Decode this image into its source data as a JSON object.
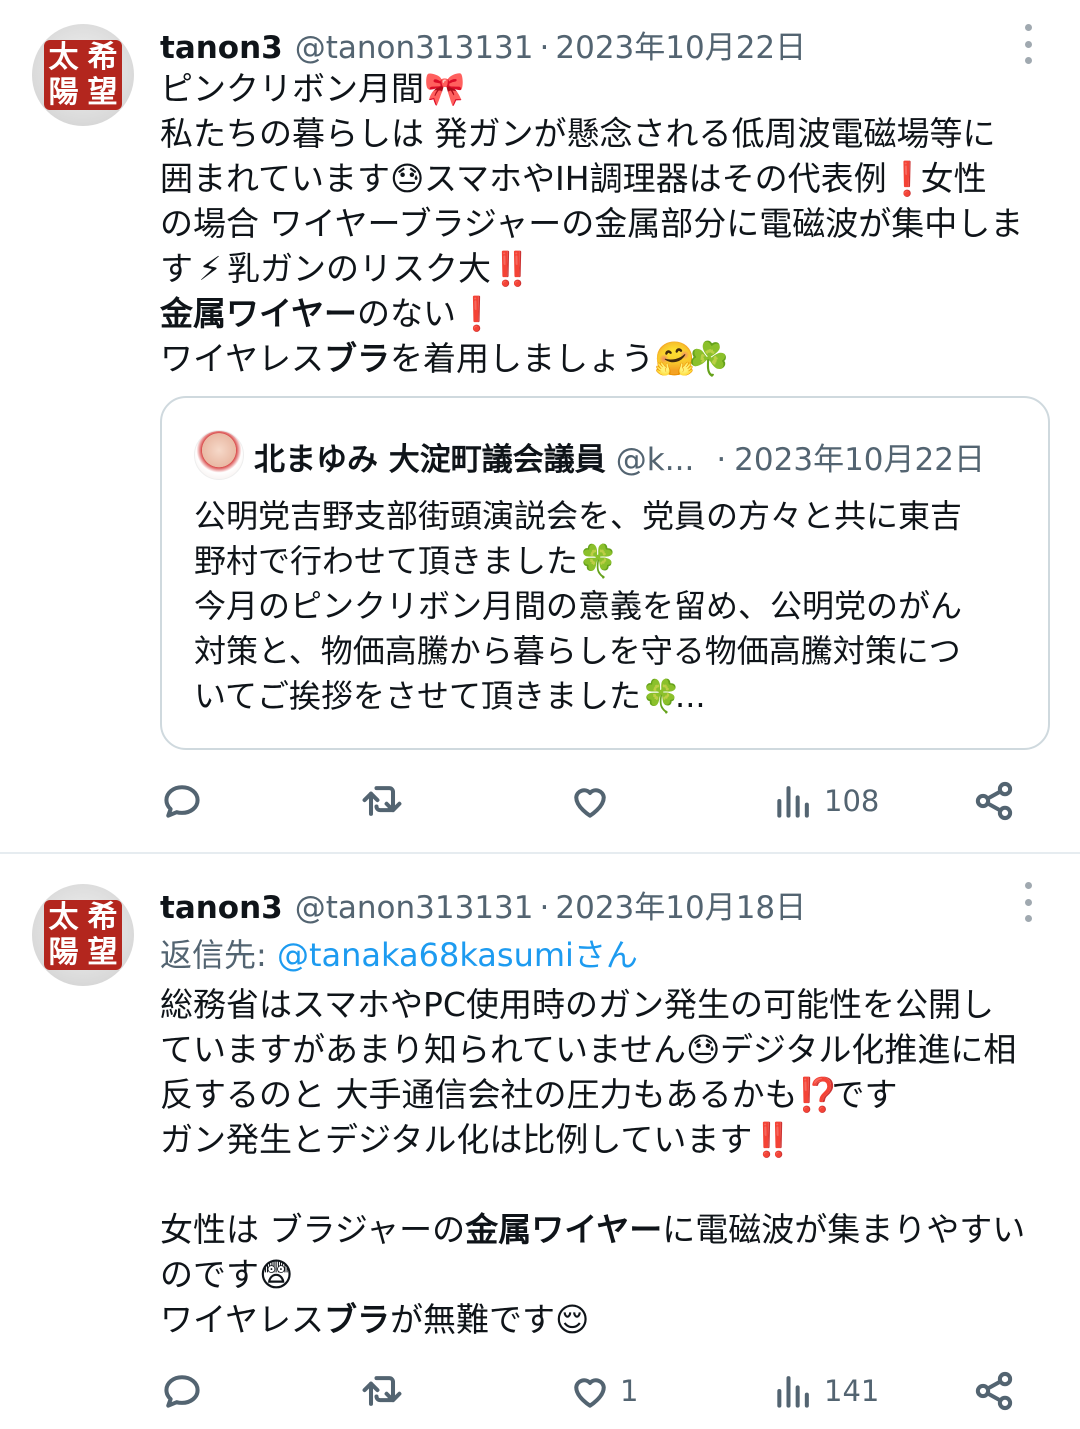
{
  "tweets": [
    {
      "display_name": "tanon3",
      "handle": "@tanon313131",
      "separator": "·",
      "date": "2023年10月22日",
      "avatar_seal": [
        "太",
        "希",
        "陽",
        "望"
      ],
      "lines": [
        [
          {
            "t": "ピンクリボン月間"
          },
          {
            "e": "🎀"
          }
        ],
        [
          {
            "t": "私たちの暮らしは 発ガンが懸念される低周波電磁場等に"
          }
        ],
        [
          {
            "t": "囲まれています"
          },
          {
            "e": "😓"
          },
          {
            "t": "スマホやIH調理器はその代表例"
          },
          {
            "e": "❗"
          },
          {
            "t": "女性"
          }
        ],
        [
          {
            "t": "の場合 ワイヤーブラジャーの金属部分に電磁波が集中しま"
          }
        ],
        [
          {
            "t": "す"
          },
          {
            "e": "⚡"
          },
          {
            "t": "乳ガンのリスク大"
          },
          {
            "e": "‼️"
          }
        ],
        [
          {
            "b": "金属ワイヤー"
          },
          {
            "t": "のない"
          },
          {
            "e": "❗"
          }
        ],
        [
          {
            "t": "ワイヤレス"
          },
          {
            "b": "ブラ"
          },
          {
            "t": "を着用しましょう"
          },
          {
            "e": "🤗"
          },
          {
            "e": "☘️"
          }
        ]
      ],
      "quote": {
        "display_name": "北まゆみ 大淀町議会議員",
        "handle": "@k...",
        "separator": "·",
        "date": "2023年10月22日",
        "lines": [
          [
            {
              "t": "公明党吉野支部街頭演説会を、党員の方々と共に東吉"
            }
          ],
          [
            {
              "t": "野村で行わせて頂きました"
            },
            {
              "e": "🍀"
            }
          ],
          [
            {
              "t": "今月のピンクリボン月間の意義を留め、公明党のがん"
            }
          ],
          [
            {
              "t": "対策と、物価高騰から暮らしを守る物価高騰対策につ"
            }
          ],
          [
            {
              "t": "いてご挨拶をさせて頂きました"
            },
            {
              "e": "🍀"
            },
            {
              "t": "..."
            }
          ]
        ]
      },
      "actions": {
        "reply": "",
        "retweet": "",
        "like": "",
        "views": "108"
      }
    },
    {
      "display_name": "tanon3",
      "handle": "@tanon313131",
      "separator": "·",
      "date": "2023年10月18日",
      "avatar_seal": [
        "太",
        "希",
        "陽",
        "望"
      ],
      "reply_label": "返信先: ",
      "reply_mention": "@tanaka68kasumiさん",
      "lines": [
        [
          {
            "t": "総務省はスマホやPC使用時のガン発生の可能性を公開し"
          }
        ],
        [
          {
            "t": "ていますがあまり知られていません"
          },
          {
            "e": "😓"
          },
          {
            "t": "デジタル化推進に相"
          }
        ],
        [
          {
            "t": "反するのと 大手通信会社の圧力もあるかも"
          },
          {
            "e": "⁉️"
          },
          {
            "t": "です"
          }
        ],
        [
          {
            "t": "ガン発生とデジタル化は比例しています"
          },
          {
            "e": "‼️"
          }
        ],
        [],
        [
          {
            "t": "女性は ブラジャーの"
          },
          {
            "b": "金属ワイヤー"
          },
          {
            "t": "に電磁波が集まりやすい"
          }
        ],
        [
          {
            "t": "のです"
          },
          {
            "e": "😨"
          }
        ],
        [
          {
            "t": "ワイヤレス"
          },
          {
            "b": "ブラ"
          },
          {
            "t": "が無難です"
          },
          {
            "e": "😌"
          }
        ]
      ],
      "actions": {
        "reply": "",
        "retweet": "",
        "like": "1",
        "views": "141"
      }
    }
  ],
  "icons": {
    "reply": "reply-icon",
    "retweet": "retweet-icon",
    "like": "heart-icon",
    "views": "views-icon",
    "share": "share-icon",
    "more": "more-options-icon"
  },
  "colors": {
    "text": "#0f1419",
    "secondary": "#536471",
    "link": "#1d9bf0",
    "seal": "#b3261e",
    "border": "#cfd9de"
  }
}
